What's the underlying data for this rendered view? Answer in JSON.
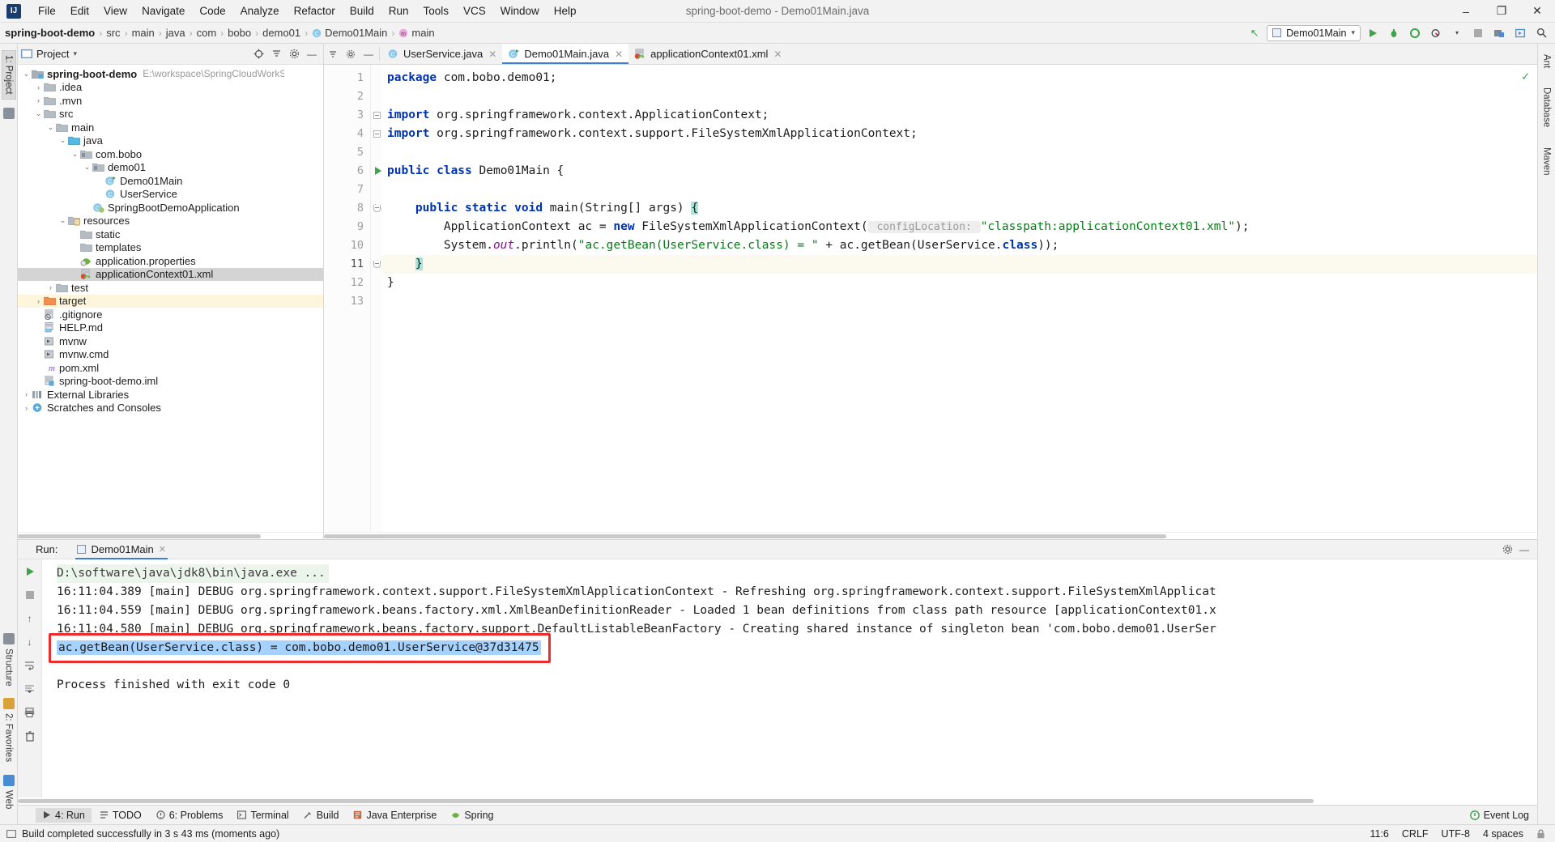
{
  "window": {
    "title": "spring-boot-demo - Demo01Main.java",
    "logo": "intellij-idea-logo",
    "minimize": "–",
    "maximize": "❐",
    "close": "✕"
  },
  "menu": {
    "items": [
      "File",
      "Edit",
      "View",
      "Navigate",
      "Code",
      "Analyze",
      "Refactor",
      "Build",
      "Run",
      "Tools",
      "VCS",
      "Window",
      "Help"
    ]
  },
  "breadcrumb": {
    "items": [
      "spring-boot-demo",
      "src",
      "main",
      "java",
      "com",
      "bobo",
      "demo01",
      "Demo01Main",
      "main"
    ]
  },
  "toolbar": {
    "run_config": "Demo01Main",
    "dropdown_caret": "▾",
    "buttons": [
      "run-button",
      "debug-button",
      "run-coverage-button",
      "profiler-button",
      "stop-button",
      "build-button",
      "preview-button",
      "search-everywhere-button"
    ],
    "back_arrow": "↖"
  },
  "left_strip": {
    "tabs": [
      "1: Project",
      "Structure",
      "2: Favorites",
      "Web"
    ]
  },
  "right_strip": {
    "tabs": [
      "Ant",
      "Database",
      "Maven"
    ]
  },
  "project_panel": {
    "title": "Project",
    "caret": "▾",
    "header_buttons": [
      "locate-button",
      "collapse-all-button",
      "settings-button",
      "hide-button"
    ],
    "tree": [
      {
        "depth": 0,
        "arrow": "v",
        "label": "spring-boot-demo",
        "bold": true,
        "icon": "module-folder",
        "path": "E:\\workspace\\SpringCloudWorkSpace\\spring-boot-d"
      },
      {
        "depth": 1,
        "arrow": ">",
        "label": ".idea",
        "icon": "folder"
      },
      {
        "depth": 1,
        "arrow": ">",
        "label": ".mvn",
        "icon": "folder"
      },
      {
        "depth": 1,
        "arrow": "v",
        "label": "src",
        "icon": "folder"
      },
      {
        "depth": 2,
        "arrow": "v",
        "label": "main",
        "icon": "folder"
      },
      {
        "depth": 3,
        "arrow": "v",
        "label": "java",
        "icon": "source-folder"
      },
      {
        "depth": 4,
        "arrow": "v",
        "label": "com.bobo",
        "icon": "package"
      },
      {
        "depth": 5,
        "arrow": "v",
        "label": "demo01",
        "icon": "package"
      },
      {
        "depth": 6,
        "arrow": "",
        "label": "Demo01Main",
        "icon": "java-class-runnable"
      },
      {
        "depth": 6,
        "arrow": "",
        "label": "UserService",
        "icon": "java-class"
      },
      {
        "depth": 5,
        "arrow": "",
        "label": "SpringBootDemoApplication",
        "icon": "spring-boot-class"
      },
      {
        "depth": 3,
        "arrow": "v",
        "label": "resources",
        "icon": "resources-folder"
      },
      {
        "depth": 4,
        "arrow": "",
        "label": "static",
        "icon": "folder"
      },
      {
        "depth": 4,
        "arrow": "",
        "label": "templates",
        "icon": "folder"
      },
      {
        "depth": 4,
        "arrow": "",
        "label": "application.properties",
        "icon": "spring-properties"
      },
      {
        "depth": 4,
        "arrow": "",
        "label": "applicationContext01.xml",
        "icon": "spring-xml",
        "selected": true
      },
      {
        "depth": 2,
        "arrow": ">",
        "label": "test",
        "icon": "folder"
      },
      {
        "depth": 1,
        "arrow": ">",
        "label": "target",
        "icon": "excluded-folder",
        "highlight": true
      },
      {
        "depth": 1,
        "arrow": "",
        "label": ".gitignore",
        "icon": "gitignore-file"
      },
      {
        "depth": 1,
        "arrow": "",
        "label": "HELP.md",
        "icon": "markdown-file"
      },
      {
        "depth": 1,
        "arrow": "",
        "label": "mvnw",
        "icon": "script-file"
      },
      {
        "depth": 1,
        "arrow": "",
        "label": "mvnw.cmd",
        "icon": "script-file"
      },
      {
        "depth": 1,
        "arrow": "",
        "label": "pom.xml",
        "icon": "maven-pom-file"
      },
      {
        "depth": 1,
        "arrow": "",
        "label": "spring-boot-demo.iml",
        "icon": "iml-file"
      },
      {
        "depth": 0,
        "arrow": ">",
        "label": "External Libraries",
        "icon": "libraries"
      },
      {
        "depth": 0,
        "arrow": ">",
        "label": "Scratches and Consoles",
        "icon": "scratches"
      }
    ]
  },
  "editor": {
    "tabs": [
      {
        "label": "UserService.java",
        "icon": "java-class",
        "active": false,
        "close": "✕"
      },
      {
        "label": "Demo01Main.java",
        "icon": "java-class-runnable",
        "active": true,
        "close": "✕"
      },
      {
        "label": "applicationContext01.xml",
        "icon": "spring-xml",
        "active": false,
        "close": "✕"
      }
    ],
    "tab_tools": [
      "sort-button",
      "settings-button",
      "hide-button"
    ],
    "inspection_status": "✓",
    "line_numbers": [
      "1",
      "2",
      "3",
      "4",
      "5",
      "6",
      "7",
      "8",
      "9",
      "10",
      "11",
      "12",
      "13"
    ],
    "current_line": 11,
    "run_markers": [
      6,
      8
    ],
    "code_lines": [
      {
        "n": 1,
        "parts": [
          {
            "t": "package ",
            "c": "kw"
          },
          {
            "t": "com.bobo.demo01;",
            "c": ""
          }
        ]
      },
      {
        "n": 2,
        "parts": []
      },
      {
        "n": 3,
        "parts": [
          {
            "t": "import ",
            "c": "kw"
          },
          {
            "t": "org.springframework.context.ApplicationContext;",
            "c": ""
          }
        ]
      },
      {
        "n": 4,
        "parts": [
          {
            "t": "import ",
            "c": "kw"
          },
          {
            "t": "org.springframework.context.support.FileSystemXmlApplicationContext;",
            "c": ""
          }
        ]
      },
      {
        "n": 5,
        "parts": []
      },
      {
        "n": 6,
        "parts": [
          {
            "t": "public class ",
            "c": "kw"
          },
          {
            "t": "Demo01Main {",
            "c": ""
          }
        ]
      },
      {
        "n": 7,
        "parts": []
      },
      {
        "n": 8,
        "parts": [
          {
            "t": "    public static void ",
            "c": "kw"
          },
          {
            "t": "main(String[] args) ",
            "c": ""
          },
          {
            "t": "{",
            "c": "brmatch"
          }
        ]
      },
      {
        "n": 9,
        "parts": [
          {
            "t": "        ApplicationContext ac = ",
            "c": ""
          },
          {
            "t": "new ",
            "c": "kw"
          },
          {
            "t": "FileSystemXmlApplicationContext(",
            "c": ""
          },
          {
            "t": " configLocation: ",
            "c": "hint"
          },
          {
            "t": "\"classpath:applicationContext01.xml\"",
            "c": "str"
          },
          {
            "t": ");",
            "c": ""
          }
        ]
      },
      {
        "n": 10,
        "parts": [
          {
            "t": "        System.",
            "c": ""
          },
          {
            "t": "out",
            "c": "fld"
          },
          {
            "t": ".println(",
            "c": ""
          },
          {
            "t": "\"ac.getBean(UserService.class) = \"",
            "c": "str"
          },
          {
            "t": " + ac.getBean(UserService.",
            "c": ""
          },
          {
            "t": "class",
            "c": "kw"
          },
          {
            "t": "));",
            "c": ""
          }
        ]
      },
      {
        "n": 11,
        "parts": [
          {
            "t": "    ",
            "c": ""
          },
          {
            "t": "}",
            "c": "brmatch"
          }
        ]
      },
      {
        "n": 12,
        "parts": [
          {
            "t": "}",
            "c": ""
          }
        ]
      },
      {
        "n": 13,
        "parts": []
      }
    ]
  },
  "run_panel": {
    "run_label": "Run:",
    "tab_label": "Demo01Main",
    "tab_close": "✕",
    "settings_icon": "gear-icon",
    "hide_icon": "minimize-icon",
    "side_tools": [
      "rerun-button",
      "stop-button",
      "resume-button",
      "pause-button",
      "scroll-up-button",
      "scroll-down-button",
      "soft-wrap-button",
      "print-button",
      "clear-all-button"
    ],
    "console_lines": [
      {
        "text": "D:\\software\\java\\jdk8\\bin\\java.exe ...",
        "style": "cmd"
      },
      {
        "text": "16:11:04.389 [main] DEBUG org.springframework.context.support.FileSystemXmlApplicationContext - Refreshing org.springframework.context.support.FileSystemXmlApplicat",
        "style": "plain"
      },
      {
        "text": "16:11:04.559 [main] DEBUG org.springframework.beans.factory.xml.XmlBeanDefinitionReader - Loaded 1 bean definitions from class path resource [applicationContext01.x",
        "style": "plain"
      },
      {
        "text": "16:11:04.580 [main] DEBUG org.springframework.beans.factory.support.DefaultListableBeanFactory - Creating shared instance of singleton bean 'com.bobo.demo01.UserSer",
        "style": "plain"
      },
      {
        "text": "ac.getBean(UserService.class) = com.bobo.demo01.UserService@37d31475",
        "style": "highlighted"
      },
      {
        "text": "",
        "style": "plain"
      },
      {
        "text": "Process finished with exit code 0",
        "style": "plain"
      }
    ],
    "highlight_color": "#a6d2ff",
    "annotation_box_color": "#ef2b2b"
  },
  "bottom_toolbar": {
    "items": [
      {
        "label": "4: Run",
        "icon": "run-icon",
        "active": true
      },
      {
        "label": "TODO",
        "icon": "todo-icon",
        "active": false
      },
      {
        "label": "6: Problems",
        "icon": "problems-icon",
        "active": false
      },
      {
        "label": "Terminal",
        "icon": "terminal-icon",
        "active": false
      },
      {
        "label": "Build",
        "icon": "build-icon",
        "active": false
      },
      {
        "label": "Java Enterprise",
        "icon": "java-enterprise-icon",
        "active": false
      },
      {
        "label": "Spring",
        "icon": "spring-icon",
        "active": false
      }
    ],
    "event_log": "Event Log",
    "event_log_icon": "event-log-icon"
  },
  "status_bar": {
    "message": "Build completed successfully in 3 s 43 ms (moments ago)",
    "message_icon": "build-status-icon",
    "caret_position": "11:6",
    "line_separator": "CRLF",
    "encoding": "UTF-8",
    "indent": "4 spaces",
    "lock_icon": "lock-icon"
  },
  "colors": {
    "accent": "#3b7dd8",
    "keyword": "#0033b3",
    "string": "#067d17",
    "field": "#871094",
    "selection": "#a6d2ff",
    "annotation": "#ef2b2b",
    "run_green": "#3ea34a"
  }
}
